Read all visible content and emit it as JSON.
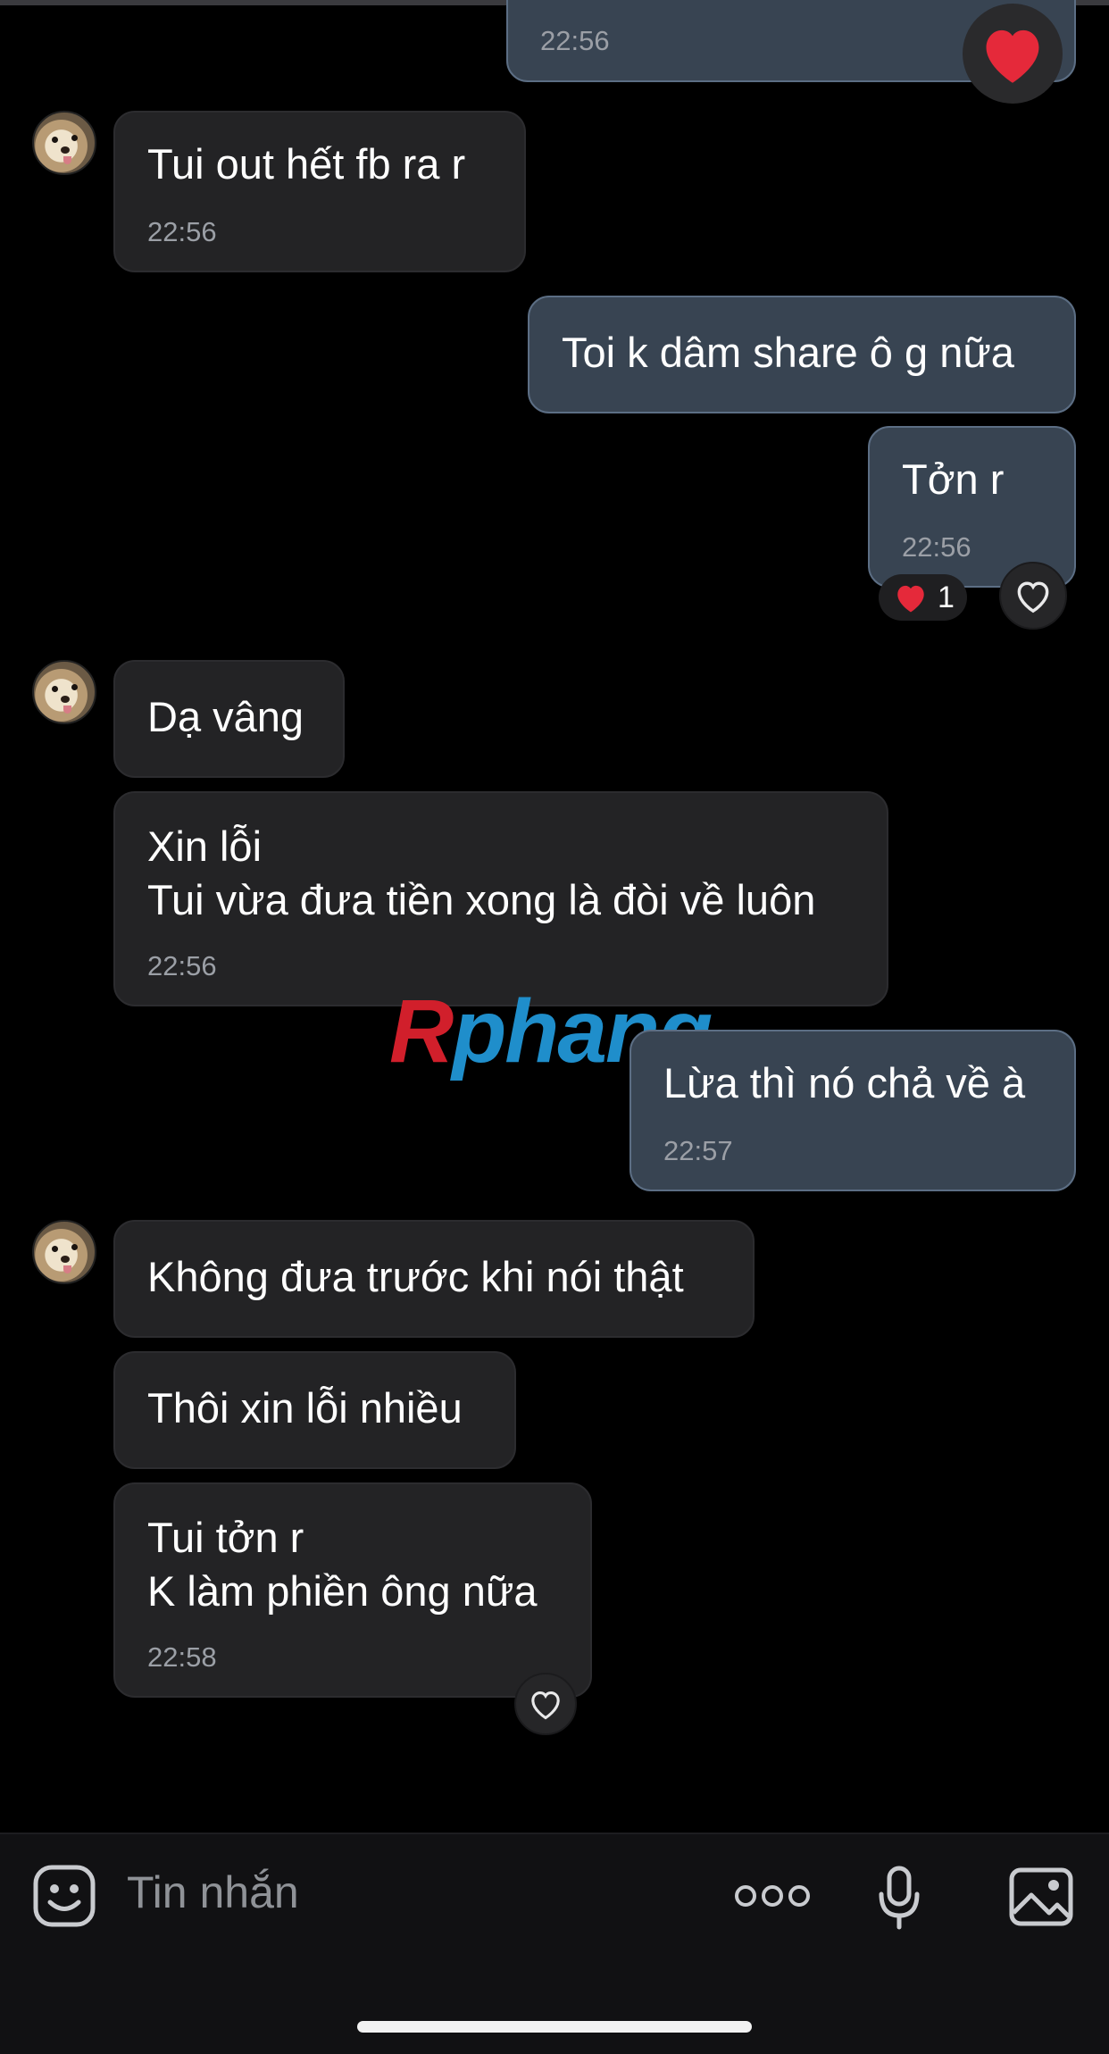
{
  "colors": {
    "incoming_bubble": "#232325",
    "outgoing_bubble": "#384452",
    "reaction_red": "#e5293a",
    "watermark_red": "#d11f2b",
    "watermark_blue": "#1f8ecb"
  },
  "messages": [
    {
      "side": "outgoing",
      "text": "",
      "time": "22:56",
      "reaction": "heart-icon"
    },
    {
      "side": "incoming",
      "text": "Tui out hết fb ra r",
      "time": "22:56"
    },
    {
      "side": "outgoing",
      "text": "Toi k dâm share ô g nữa",
      "time": ""
    },
    {
      "side": "outgoing",
      "text": "Tởn r",
      "time": "22:56",
      "reaction_count": "1"
    },
    {
      "side": "incoming",
      "text": "Dạ vâng",
      "time": ""
    },
    {
      "side": "incoming",
      "text": "Xin lỗi\nTui vừa đưa tiền xong là đòi về luôn",
      "time": "22:56"
    },
    {
      "side": "outgoing",
      "text": "Lừa thì nó chả về à",
      "time": "22:57"
    },
    {
      "side": "incoming",
      "text": "Không đưa trước khi nói thật",
      "time": ""
    },
    {
      "side": "incoming",
      "text": "Thôi xin lỗi nhiều",
      "time": ""
    },
    {
      "side": "incoming",
      "text": "Tui tởn r\nK làm phiền ông nữa",
      "time": "22:58"
    }
  ],
  "watermark": {
    "first": "R",
    "rest": "phang"
  },
  "composer": {
    "placeholder": "Tin nhắn",
    "icons": [
      "sticker-icon",
      "more-icon",
      "microphone-icon",
      "image-icon"
    ]
  }
}
